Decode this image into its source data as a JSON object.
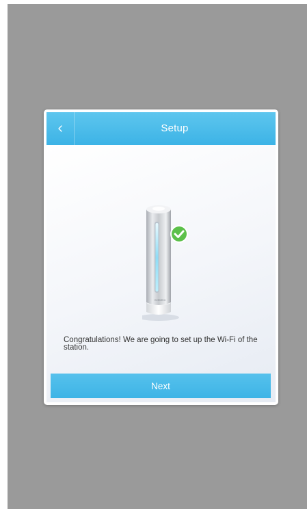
{
  "dialog": {
    "title": "Setup",
    "back_icon": "chevron-left-icon",
    "message": "Congratulations! We are going to set up the Wi-Fi of the station.",
    "device_brand": "netatmo",
    "success_icon": "check-circle-icon",
    "next_label": "Next"
  },
  "colors": {
    "accent": "#3cb3e6",
    "backdrop": "#9a9a9a",
    "success": "#5cc04a",
    "led": "#7fd8f4"
  }
}
